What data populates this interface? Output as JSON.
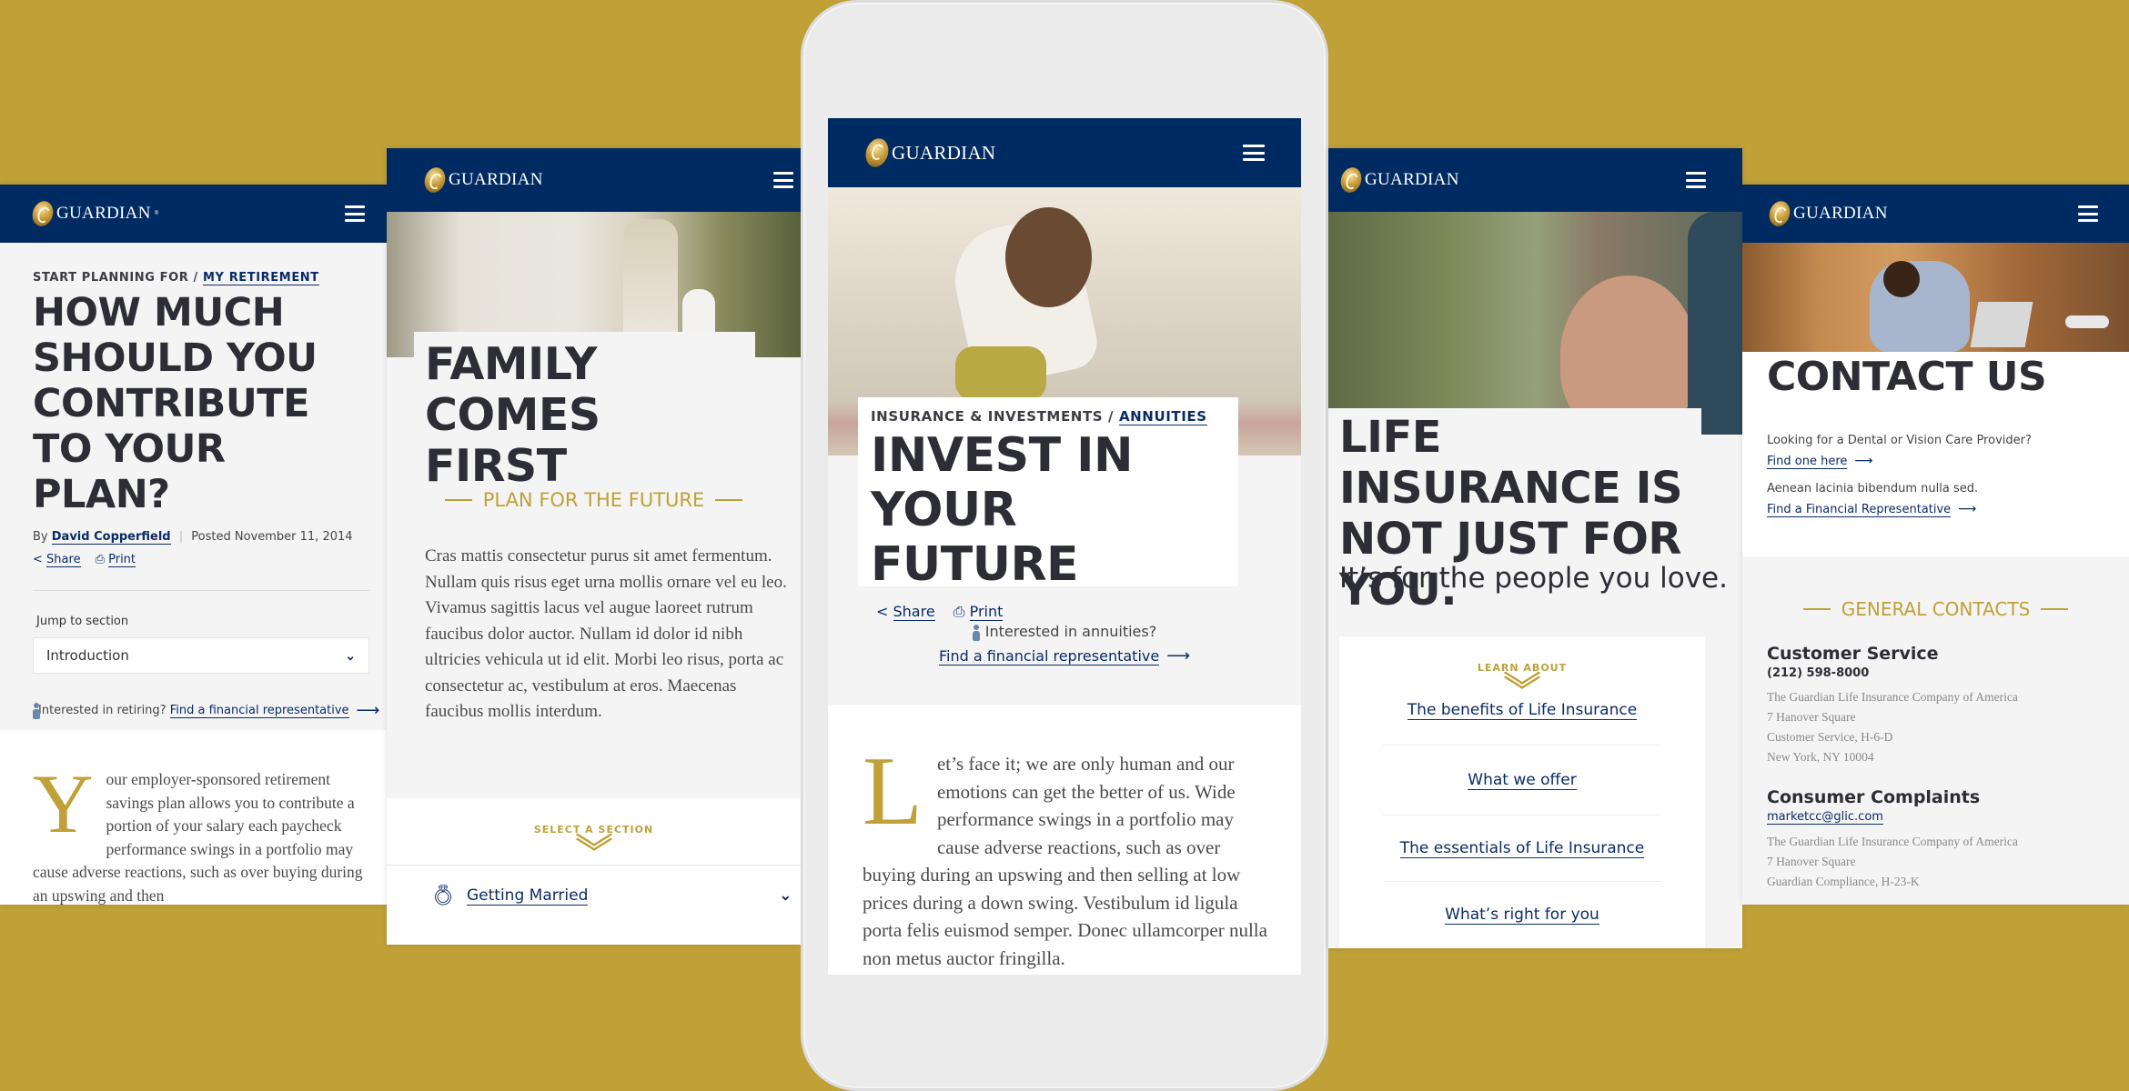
{
  "brand": {
    "name": "GUARDIAN",
    "colors": {
      "background": "#bfa138",
      "navy": "#002b62",
      "gold": "#bfa138",
      "text": "#2d2d35",
      "link": "#0a2b66"
    },
    "logo_icon": "guardian-g-logo-icon",
    "menu_icon": "hamburger-menu-icon"
  },
  "panel_retirement": {
    "breadcrumb_prefix": "START PLANNING FOR /",
    "breadcrumb_link": "MY RETIREMENT",
    "title": "HOW MUCH SHOULD YOU CONTRIBUTE TO YOUR PLAN?",
    "byline_prefix": "By",
    "author": "David Copperfield",
    "posted": "Posted November 11, 2014",
    "share_label": "Share",
    "print_label": "Print",
    "jump_label": "Jump to section",
    "jump_selected": "Introduction",
    "cta_text": "Interested in retiring?",
    "cta_link": "Find a financial representative",
    "dropcap": "Y",
    "body": "our employer-sponsored retirement savings plan allows you to contribute a portion of your salary each paycheck performance swings in a portfolio may cause adverse reactions, such as over buying during an upswing and then"
  },
  "panel_family": {
    "title": "FAMILY COMES FIRST",
    "section_title": "PLAN FOR THE FUTURE",
    "body": "Cras mattis consectetur purus sit amet fermentum. Nullam quis risus eget urna mollis ornare vel eu leo. Vivamus sagittis lacus vel augue laoreet rutrum faucibus dolor auctor. Nullam id dolor id nibh ultricies vehicula ut id elit. Morbi leo risus, porta ac consectetur ac, vestibulum at eros. Maecenas faucibus mollis interdum.",
    "select_label": "SELECT A SECTION",
    "section_item": "Getting Married",
    "section_item_icon": "ring-icon"
  },
  "panel_annuities": {
    "breadcrumb_prefix": "INSURANCE & INVESTMENTS /",
    "breadcrumb_link": "ANNUITIES",
    "title": "INVEST IN YOUR FUTURE",
    "share_label": "Share",
    "print_label": "Print",
    "cta_text": "Interested in annuities?",
    "cta_link": "Find a financial representative",
    "dropcap": "L",
    "body": "et’s face it; we are only human and our emotions can get the better of us. Wide performance swings in a portfolio may cause adverse reactions, such as over buying during an upswing and then selling at low prices during a down swing. Vestibulum id ligula porta felis euismod semper. Donec ullamcorper nulla non metus auctor fringilla."
  },
  "panel_life": {
    "title": "LIFE INSURANCE IS NOT JUST FOR YOU.",
    "subtitle": "It’s for the people you love.",
    "learn_label": "LEARN ABOUT",
    "links": [
      "The benefits of Life Insurance",
      "What we offer",
      "The essentials of Life Insurance",
      "What’s right for you"
    ]
  },
  "panel_contact": {
    "title": "CONTACT US",
    "q1": "Looking for a Dental or Vision Care Provider?",
    "link1": "Find one here",
    "q2": "Aenean lacinia bibendum nulla sed.",
    "link2": "Find a Financial Representative",
    "section_title": "GENERAL CONTACTS",
    "contacts": [
      {
        "name": "Customer Service",
        "detail": "(212) 598-8000",
        "address": [
          "The Guardian Life Insurance Company of America",
          "7 Hanover Square",
          "Customer Service, H-6-D",
          "New York, NY 10004"
        ]
      },
      {
        "name": "Consumer Complaints",
        "detail": "marketcc@glic.com",
        "address": [
          "The Guardian Life Insurance Company of America",
          "7 Hanover Square",
          "Guardian Compliance, H-23-K"
        ]
      }
    ]
  }
}
